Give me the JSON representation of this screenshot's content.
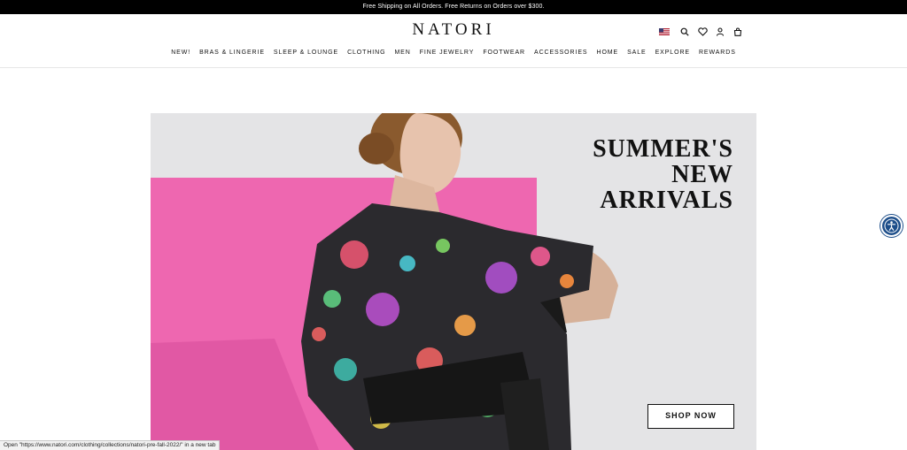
{
  "promo": {
    "text": "Free Shipping on All Orders. Free Returns on Orders over $300."
  },
  "header": {
    "logo": "NATORI",
    "utility_icons": [
      "us-flag-icon",
      "search-icon",
      "heart-icon",
      "account-icon",
      "bag-icon"
    ]
  },
  "nav": {
    "items": [
      {
        "label": "NEW!"
      },
      {
        "label": "BRAS & LINGERIE"
      },
      {
        "label": "SLEEP & LOUNGE"
      },
      {
        "label": "CLOTHING"
      },
      {
        "label": "MEN"
      },
      {
        "label": "FINE JEWELRY"
      },
      {
        "label": "FOOTWEAR"
      },
      {
        "label": "ACCESSORIES"
      },
      {
        "label": "HOME"
      },
      {
        "label": "SALE"
      },
      {
        "label": "EXPLORE"
      },
      {
        "label": "REWARDS"
      }
    ]
  },
  "hero": {
    "headline": [
      "SUMMER'S",
      "NEW",
      "ARRIVALS"
    ],
    "cta": "SHOP NOW",
    "colors": {
      "backdrop": "#e4e4e6",
      "pink_panel": "#ee67b0"
    }
  },
  "accessibility": {
    "icon": "accessibility-icon"
  },
  "status": {
    "text": "Open \"https://www.natori.com/clothing/collections/natori-pre-fall-2022/\" in a new tab"
  }
}
